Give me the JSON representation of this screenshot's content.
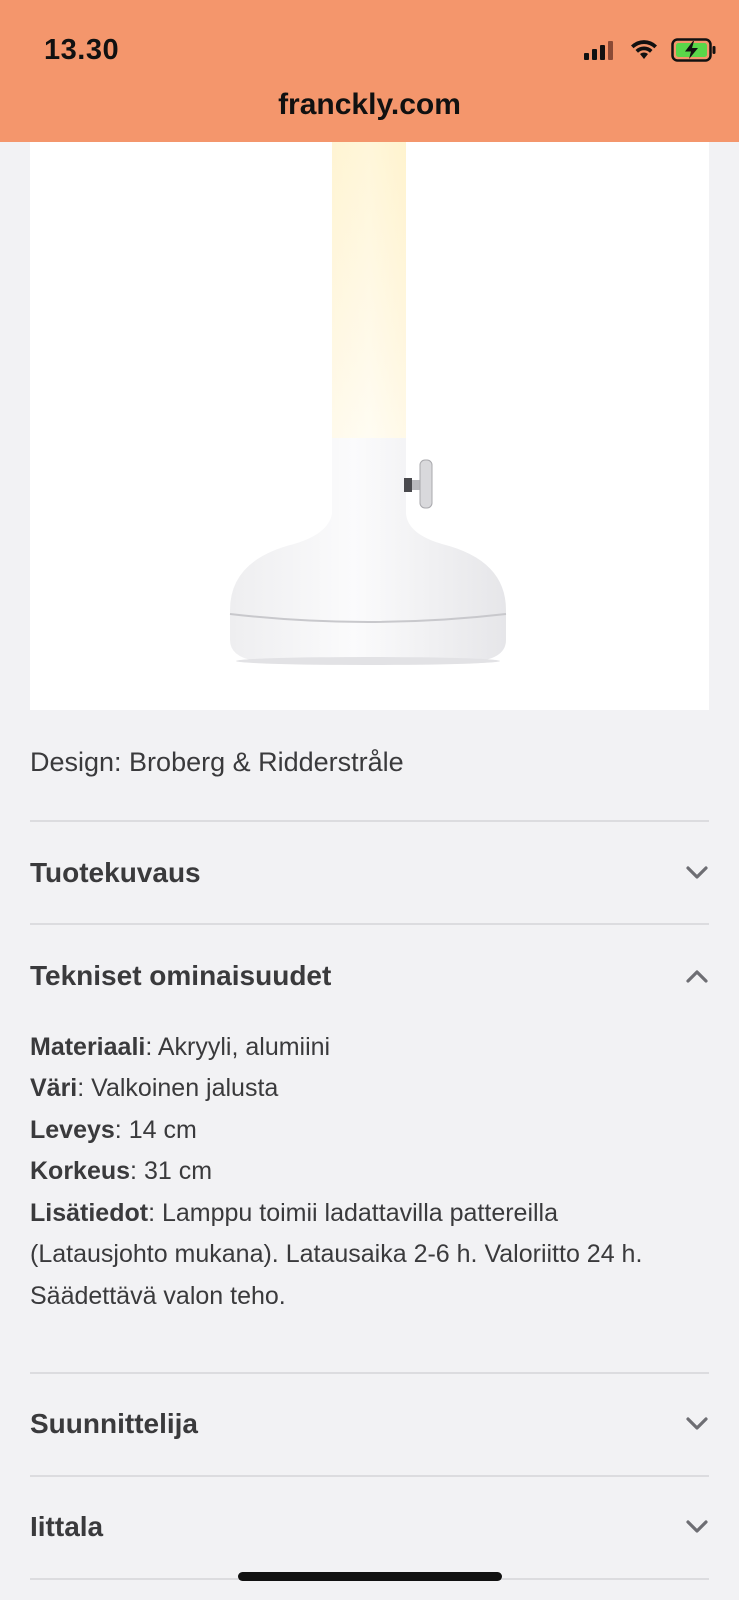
{
  "status_bar": {
    "time": "13.30",
    "url": "franckly.com",
    "bg_color": "#f4966c",
    "icons": [
      "signal-icon",
      "wifi-icon",
      "battery-charging-icon"
    ]
  },
  "product": {
    "image_alt": "white rechargeable table lamp",
    "designer_line": "Design: Broberg & Ridderstråle"
  },
  "accordion": {
    "tuotekuvaus": {
      "title": "Tuotekuvaus",
      "state": "collapsed"
    },
    "tekniset": {
      "title": "Tekniset ominaisuudet",
      "state": "expanded",
      "specs": {
        "material_label": "Materiaali",
        "material_value": ": Akryyli, alumiini",
        "color_label": "Väri",
        "color_value": ": Valkoinen jalusta",
        "width_label": "Leveys",
        "width_value": ": 14 cm",
        "height_label": "Korkeus",
        "height_value": ": 31 cm",
        "extra_label": "Lisätiedot",
        "extra_value_line1": ": Lamppu toimii ladattavilla pattereilla",
        "extra_value_line2": "(Latausjohto mukana). Latausaika 2-6 h. Valoriitto 24 h.",
        "extra_value_line3": "Säädettävä valon teho."
      }
    },
    "suunnittelija": {
      "title": "Suunnittelija",
      "state": "collapsed"
    },
    "iittala": {
      "title": "Iittala",
      "state": "collapsed"
    }
  }
}
